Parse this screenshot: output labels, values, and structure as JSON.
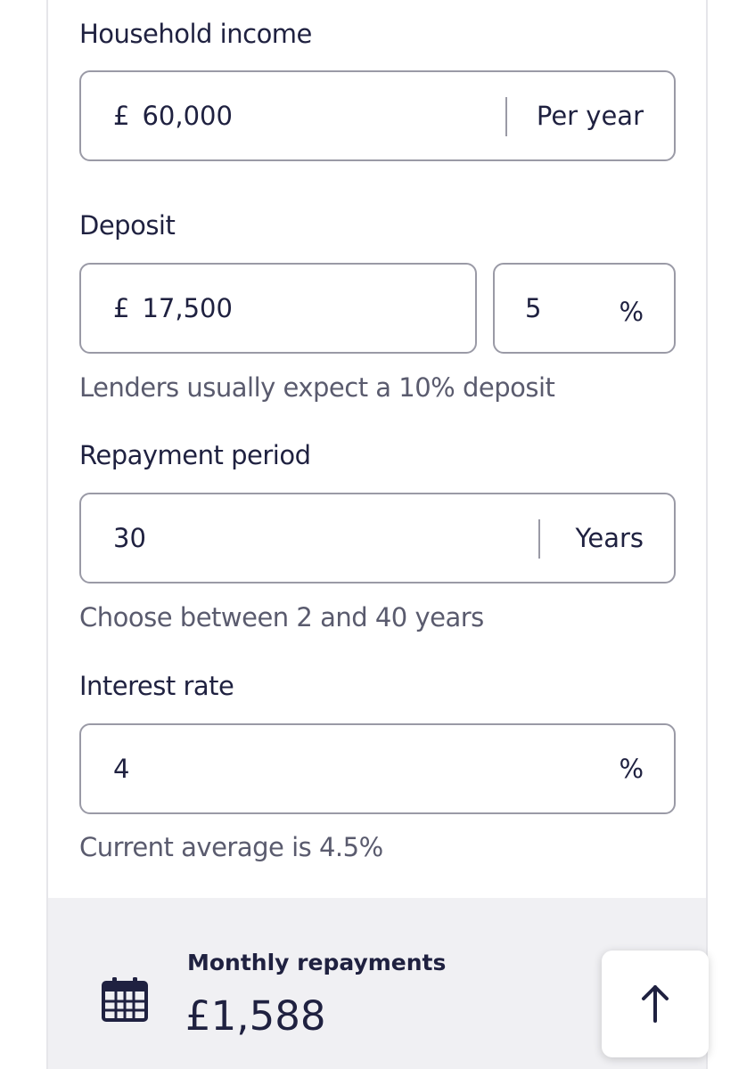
{
  "income": {
    "label": "Household income",
    "currency": "£",
    "value": "60,000",
    "unit": "Per year"
  },
  "deposit": {
    "label": "Deposit",
    "currency": "£",
    "value": "17,500",
    "percent_value": "5",
    "percent_unit": "%",
    "hint": "Lenders usually expect a 10% deposit"
  },
  "repayment": {
    "label": "Repayment period",
    "value": "30",
    "unit": "Years",
    "hint": "Choose between 2 and 40 years"
  },
  "interest": {
    "label": "Interest rate",
    "value": "4",
    "unit": "%",
    "hint": "Current average is 4.5%"
  },
  "result": {
    "label": "Monthly repayments",
    "value": "£1,588",
    "icon": "calendar-icon"
  },
  "scroll_top": {
    "icon": "arrow-up-icon"
  },
  "colors": {
    "text": "#1f2140",
    "hint": "#5a5b6e",
    "border": "#9a9aa6",
    "results_bg": "#f0f0f3"
  }
}
